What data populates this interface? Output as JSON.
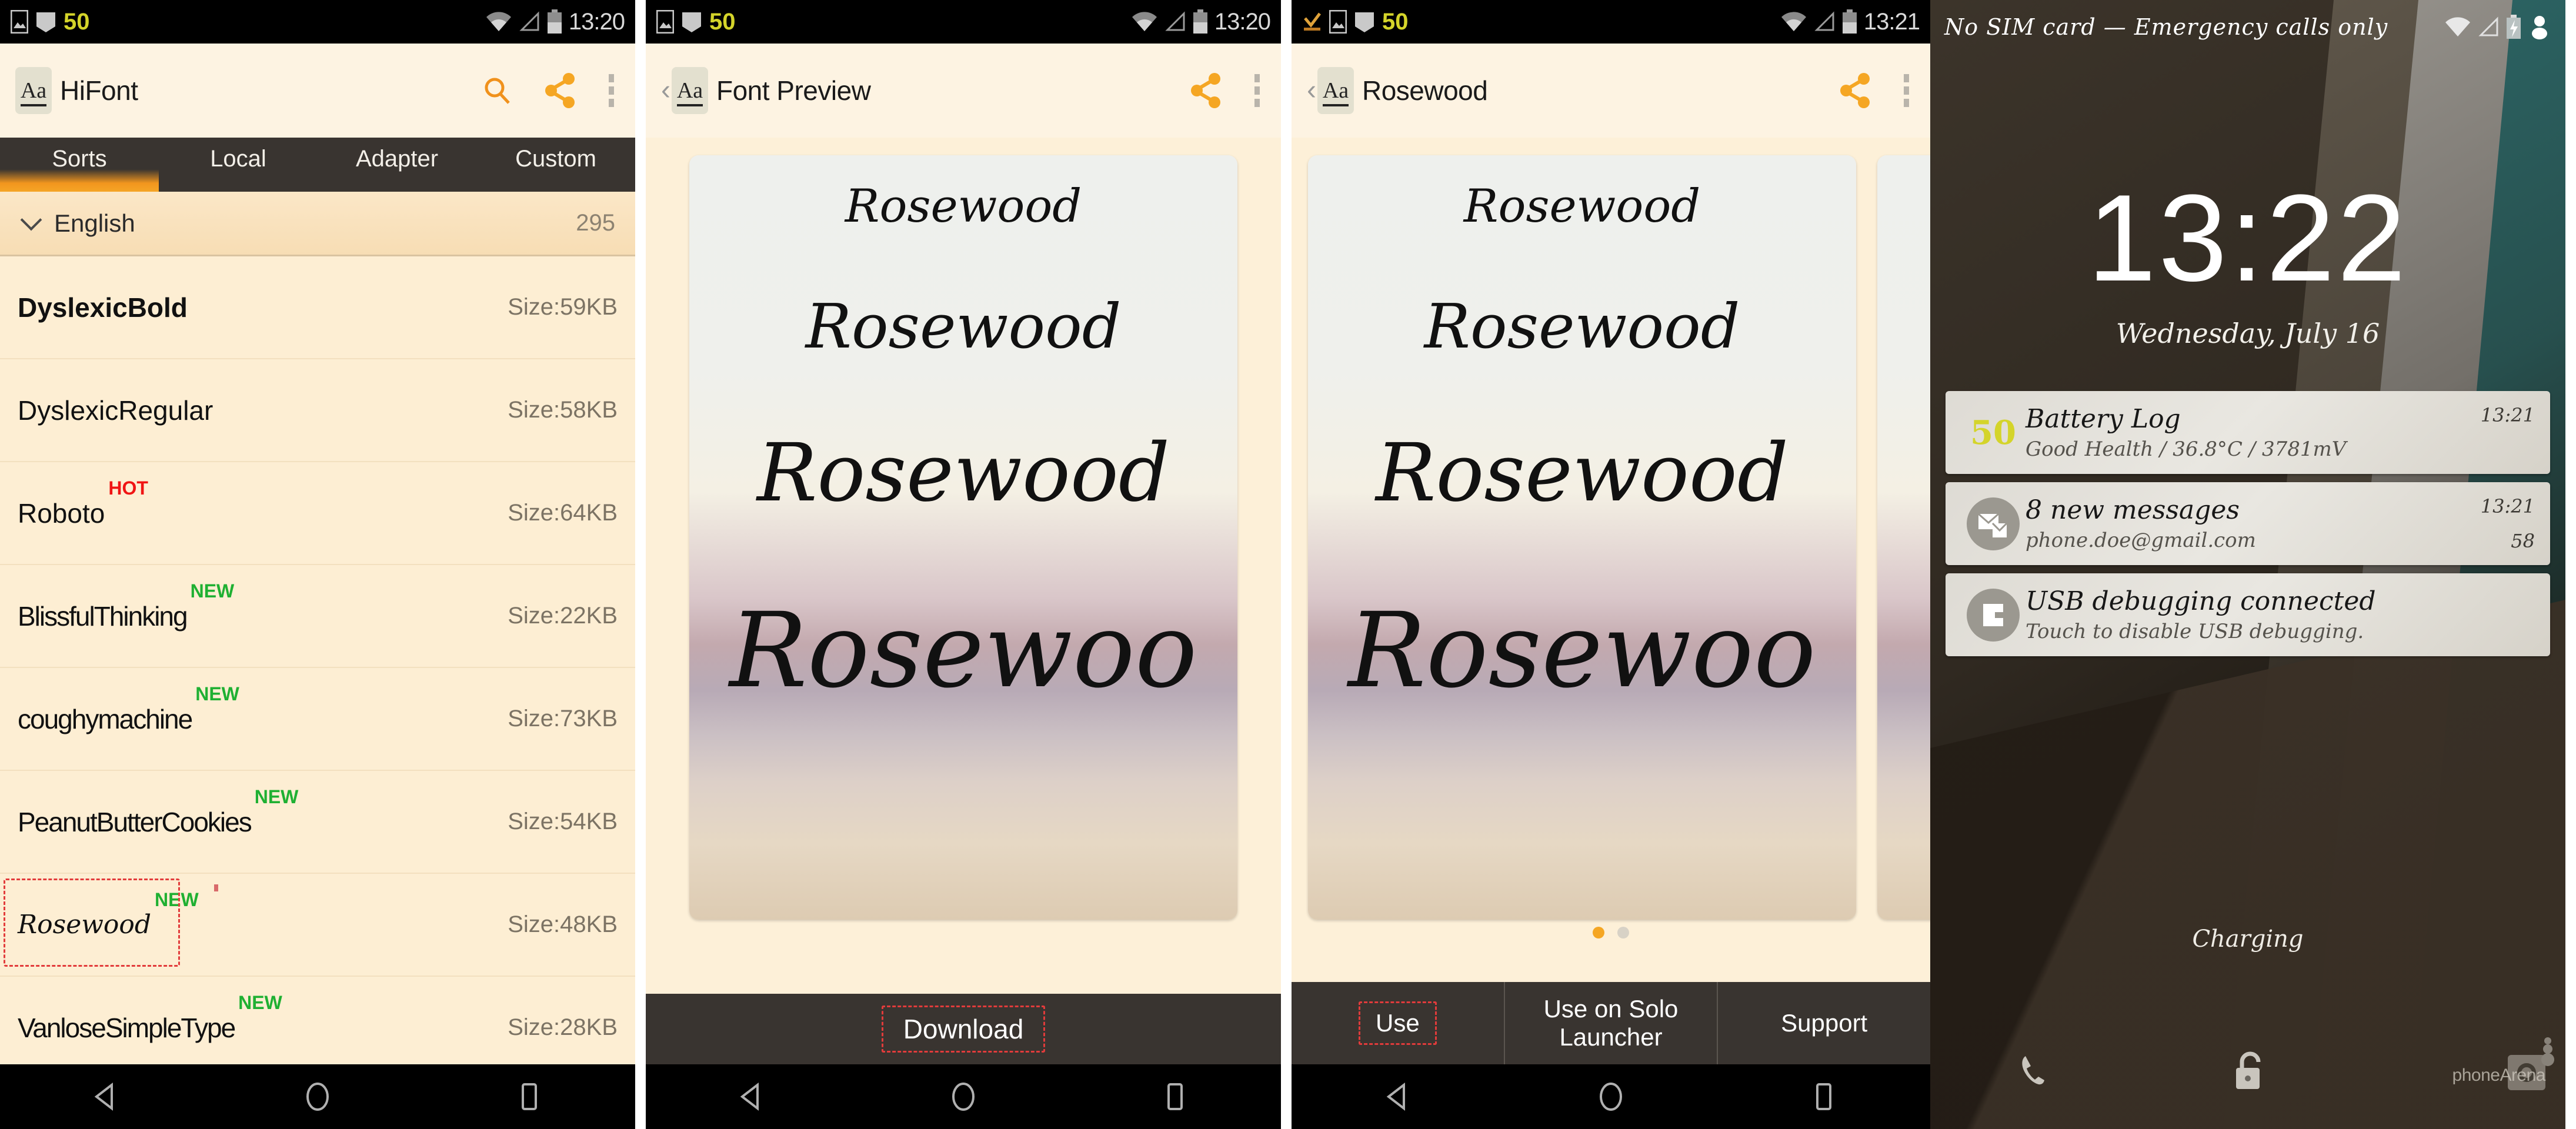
{
  "colors": {
    "accent_orange": "#f5a623",
    "app_bg": "#fdeed3",
    "actionbar_bg": "#fdf3e2",
    "tabbar_bg": "#393430",
    "tag_hot": "#f01414",
    "tag_new": "#1fb032",
    "highlight_red": "#e23b3b",
    "battery_yellow": "#d4d42a"
  },
  "screen1": {
    "statusbar": {
      "battery_badge": "50",
      "time": "13:20",
      "icons": [
        "image-icon",
        "mail-icon",
        "wifi-icon",
        "signal-icon",
        "battery-icon"
      ]
    },
    "actionbar": {
      "logo_text": "Aa",
      "title": "HiFont",
      "icons": [
        "search-icon",
        "share-icon",
        "overflow-menu-icon"
      ]
    },
    "tabs": [
      {
        "label": "Sorts",
        "active": true
      },
      {
        "label": "Local",
        "active": false
      },
      {
        "label": "Adapter",
        "active": false
      },
      {
        "label": "Custom",
        "active": false
      }
    ],
    "group": {
      "label": "English",
      "count": "295",
      "expander": "chevron-down-icon"
    },
    "fonts": [
      {
        "name": "DyslexicBold",
        "tag": "",
        "size": "Size:59KB",
        "style": "b",
        "selected": false
      },
      {
        "name": "DyslexicRegular",
        "tag": "",
        "size": "Size:58KB",
        "style": "",
        "selected": false
      },
      {
        "name": "Roboto",
        "tag": "HOT",
        "size": "Size:64KB",
        "style": "",
        "selected": false
      },
      {
        "name": "BlissfulThinking",
        "tag": "NEW",
        "size": "Size:22KB",
        "style": "cond",
        "selected": false
      },
      {
        "name": "coughymachine",
        "tag": "NEW",
        "size": "Size:73KB",
        "style": "cond",
        "selected": false
      },
      {
        "name": "PeanutButterCookies",
        "tag": "NEW",
        "size": "Size:54KB",
        "style": "cond",
        "selected": false
      },
      {
        "name": "Rosewood",
        "tag": "NEW",
        "size": "Size:48KB",
        "style": "script",
        "selected": true
      },
      {
        "name": "VanloseSimpleType",
        "tag": "NEW",
        "size": "Size:28KB",
        "style": "cond",
        "selected": false
      }
    ],
    "navbar": [
      "back-icon",
      "home-icon",
      "recents-icon"
    ]
  },
  "screen2": {
    "statusbar": {
      "battery_badge": "50",
      "time": "13:20"
    },
    "actionbar": {
      "back": "back-chevron-icon",
      "logo_text": "Aa",
      "title": "Font Preview",
      "icons": [
        "share-icon",
        "overflow-menu-icon"
      ]
    },
    "preview_lines": [
      "Rosewood",
      "Rosewood",
      "Rosewood",
      "Rosewoo"
    ],
    "download_button": "Download"
  },
  "screen3": {
    "statusbar": {
      "battery_badge": "50",
      "time": "13:21",
      "icons": [
        "download-complete-icon",
        "image-icon",
        "mail-icon",
        "wifi-icon",
        "signal-icon",
        "battery-icon"
      ]
    },
    "actionbar": {
      "back": "back-chevron-icon",
      "logo_text": "Aa",
      "title": "Rosewood",
      "icons": [
        "share-icon",
        "overflow-menu-icon"
      ]
    },
    "preview_lines": [
      "Rosewood",
      "Rosewood",
      "Rosewood",
      "Rosewoo"
    ],
    "pager": {
      "count": 2,
      "active_index": 0
    },
    "buttons": [
      {
        "label": "Use",
        "highlighted": true
      },
      {
        "label": "Use on Solo Launcher",
        "highlighted": false
      },
      {
        "label": "Support",
        "highlighted": false
      }
    ]
  },
  "screen4": {
    "statusbar": {
      "carrier": "No SIM card — Emergency calls only",
      "icons": [
        "wifi-icon",
        "signal-icon",
        "battery-charging-icon",
        "user-icon"
      ]
    },
    "clock": "13:22",
    "date": "Wednesday, July 16",
    "notifications": [
      {
        "icon": "battery-level-icon",
        "icon_text": "50",
        "title": "Battery Log",
        "subtitle": "Good Health / 36.8°C / 3781mV",
        "time": "13:21",
        "count": ""
      },
      {
        "icon": "mail-icon",
        "icon_text": "",
        "title": "8 new messages",
        "subtitle": "phone.doe@gmail.com",
        "time": "13:21",
        "count": "58"
      },
      {
        "icon": "usb-debug-icon",
        "icon_text": "",
        "title": "USB debugging connected",
        "subtitle": "Touch to disable USB debugging.",
        "time": "",
        "count": ""
      }
    ],
    "charging_text": "Charging",
    "shortcuts": [
      "phone-icon",
      "unlock-icon",
      "camera-icon"
    ],
    "watermark": "phoneArena"
  }
}
